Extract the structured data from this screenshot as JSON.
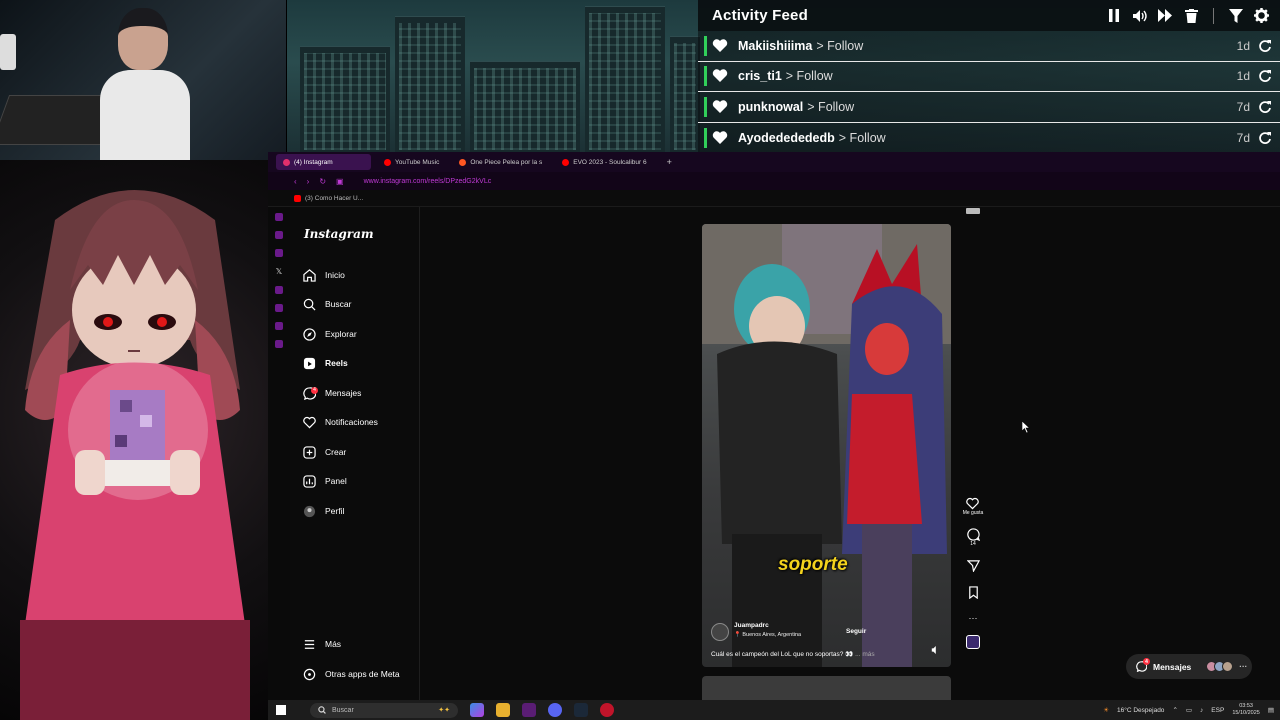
{
  "activity_feed": {
    "title": "Activity Feed",
    "controls": [
      "pause-icon",
      "volume-icon",
      "skip-icon",
      "trash-icon",
      "filter-icon",
      "settings-icon"
    ],
    "accent_color": "#31d05a",
    "items": [
      {
        "user": "Makiishiiima",
        "action": "> Follow",
        "time": "1d"
      },
      {
        "user": "cris_ti1",
        "action": "> Follow",
        "time": "1d"
      },
      {
        "user": "punknowal",
        "action": "> Follow",
        "time": "7d"
      },
      {
        "user": "Ayodededededb",
        "action": "> Follow",
        "time": "7d"
      }
    ]
  },
  "browser": {
    "tabs": [
      {
        "label": "(4) Instagram",
        "active": true,
        "color": "#e1306c"
      },
      {
        "label": "YouTube Music",
        "active": false,
        "color": "#ff0000"
      },
      {
        "label": "One Piece Pelea por la s",
        "active": false,
        "color": "#ff5722"
      },
      {
        "label": "EVO 2023 - Soulcalibur 6",
        "active": false,
        "color": "#ff0000"
      }
    ],
    "new_tab": "+",
    "url": "www.instagram.com/reels/DPzedG2kVLc",
    "bookmark": "(3) Como Hacer U..."
  },
  "instagram": {
    "logo": "Instagram",
    "nav": [
      {
        "label": "Inicio",
        "icon": "home-icon"
      },
      {
        "label": "Buscar",
        "icon": "search-icon"
      },
      {
        "label": "Explorar",
        "icon": "compass-icon"
      },
      {
        "label": "Reels",
        "icon": "reels-icon"
      },
      {
        "label": "Mensajes",
        "icon": "messenger-icon",
        "badge": "4"
      },
      {
        "label": "Notificaciones",
        "icon": "heart-icon"
      },
      {
        "label": "Crear",
        "icon": "plus-icon"
      },
      {
        "label": "Panel",
        "icon": "chart-icon"
      },
      {
        "label": "Perfil",
        "icon": "profile-icon"
      }
    ],
    "more": "Más",
    "meta_apps": "Otras apps de Meta",
    "reel": {
      "caption_word": "soporte",
      "username": "Juampadrc",
      "location": "Buenos Aires, Argentina",
      "follow": "Seguir",
      "caption": "Cuál es el campeón del LoL que no soportas? 👀",
      "more": "... más",
      "likes_label": "Me gusta",
      "comments": "14"
    },
    "messages_pill": {
      "label": "Mensajes",
      "badge": "4"
    }
  },
  "taskbar": {
    "search_placeholder": "Buscar",
    "weather": "16°C Despejado",
    "lang": "ESP",
    "time": "03:53",
    "date": "15/10/2025"
  }
}
